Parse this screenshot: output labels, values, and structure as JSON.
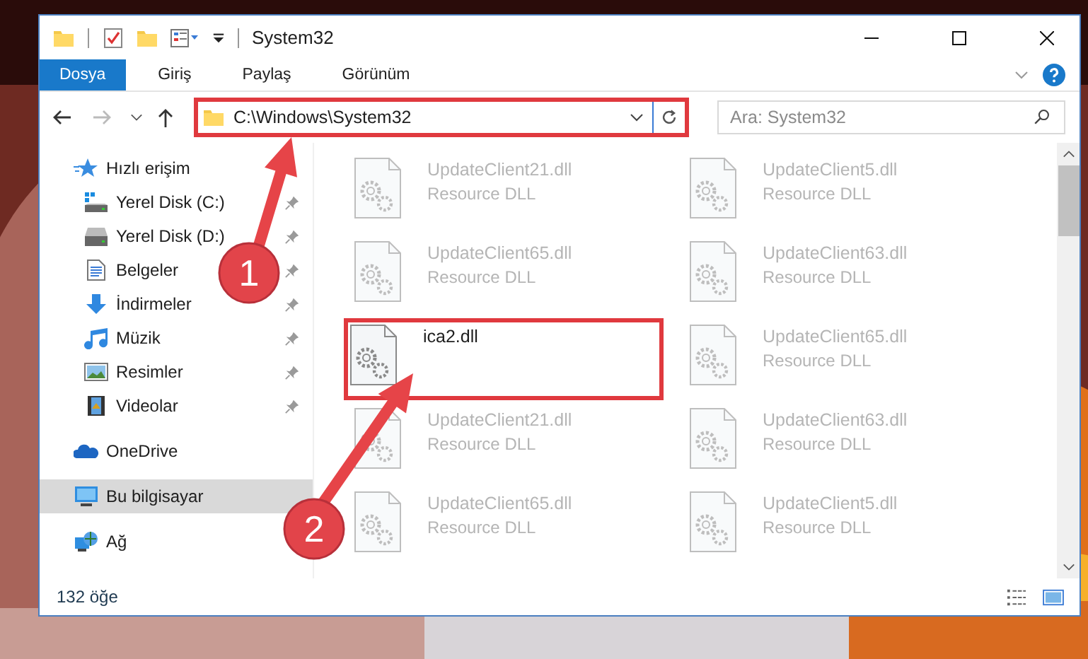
{
  "window": {
    "title": "System32"
  },
  "ribbon": {
    "tabs": [
      {
        "label": "Dosya",
        "selected": true
      },
      {
        "label": "Giriş",
        "selected": false
      },
      {
        "label": "Paylaş",
        "selected": false
      },
      {
        "label": "Görünüm",
        "selected": false
      }
    ]
  },
  "address_bar": {
    "path": "C:\\Windows\\System32",
    "highlighted": true
  },
  "search": {
    "placeholder": "Ara: System32"
  },
  "sidebar": {
    "items": [
      {
        "label": "Hızlı erişim",
        "kind": "star",
        "selected": false,
        "children": [
          {
            "label": "Yerel Disk (C:)",
            "kind": "systemdrive",
            "selected": false,
            "pinned": true
          },
          {
            "label": "Yerel Disk (D:)",
            "kind": "drive",
            "selected": false,
            "pinned": true
          },
          {
            "label": "Belgeler",
            "kind": "documents",
            "selected": false,
            "pinned": true
          },
          {
            "label": "İndirmeler",
            "kind": "downloads",
            "selected": false,
            "pinned": true
          },
          {
            "label": "Müzik",
            "kind": "music",
            "selected": false,
            "pinned": true
          },
          {
            "label": "Resimler",
            "kind": "pictures",
            "selected": false,
            "pinned": true
          },
          {
            "label": "Videolar",
            "kind": "videos",
            "selected": false,
            "pinned": true
          }
        ]
      },
      {
        "label": "OneDrive",
        "kind": "cloud",
        "selected": false
      },
      {
        "label": "Bu bilgisayar",
        "kind": "computer",
        "selected": true
      },
      {
        "label": "Ağ",
        "kind": "network",
        "selected": false
      }
    ]
  },
  "files": [
    {
      "name": "UpdateClient21.dll",
      "type": "Resource DLL",
      "faded": true,
      "highlighted": false
    },
    {
      "name": "UpdateClient5.dll",
      "type": "Resource DLL",
      "faded": true,
      "highlighted": false
    },
    {
      "name": "UpdateClient65.dll",
      "type": "Resource DLL",
      "faded": true,
      "highlighted": false
    },
    {
      "name": "UpdateClient63.dll",
      "type": "Resource DLL",
      "faded": true,
      "highlighted": false
    },
    {
      "name": "ica2.dll",
      "faded": false,
      "highlighted": true
    },
    {
      "name": "UpdateClient65.dll",
      "type": "Resource DLL",
      "faded": true,
      "highlighted": false
    },
    {
      "name": "UpdateClient21.dll",
      "type": "Resource DLL",
      "faded": true,
      "highlighted": false
    },
    {
      "name": "UpdateClient63.dll",
      "type": "Resource DLL",
      "faded": true,
      "highlighted": false
    },
    {
      "name": "UpdateClient65.dll",
      "type": "Resource DLL",
      "faded": true,
      "highlighted": false
    },
    {
      "name": "UpdateClient5.dll",
      "type": "Resource DLL",
      "faded": true,
      "highlighted": false
    }
  ],
  "status_bar": {
    "item_count": "132 öğe"
  },
  "annotations": [
    {
      "number": "1"
    },
    {
      "number": "2"
    }
  ]
}
